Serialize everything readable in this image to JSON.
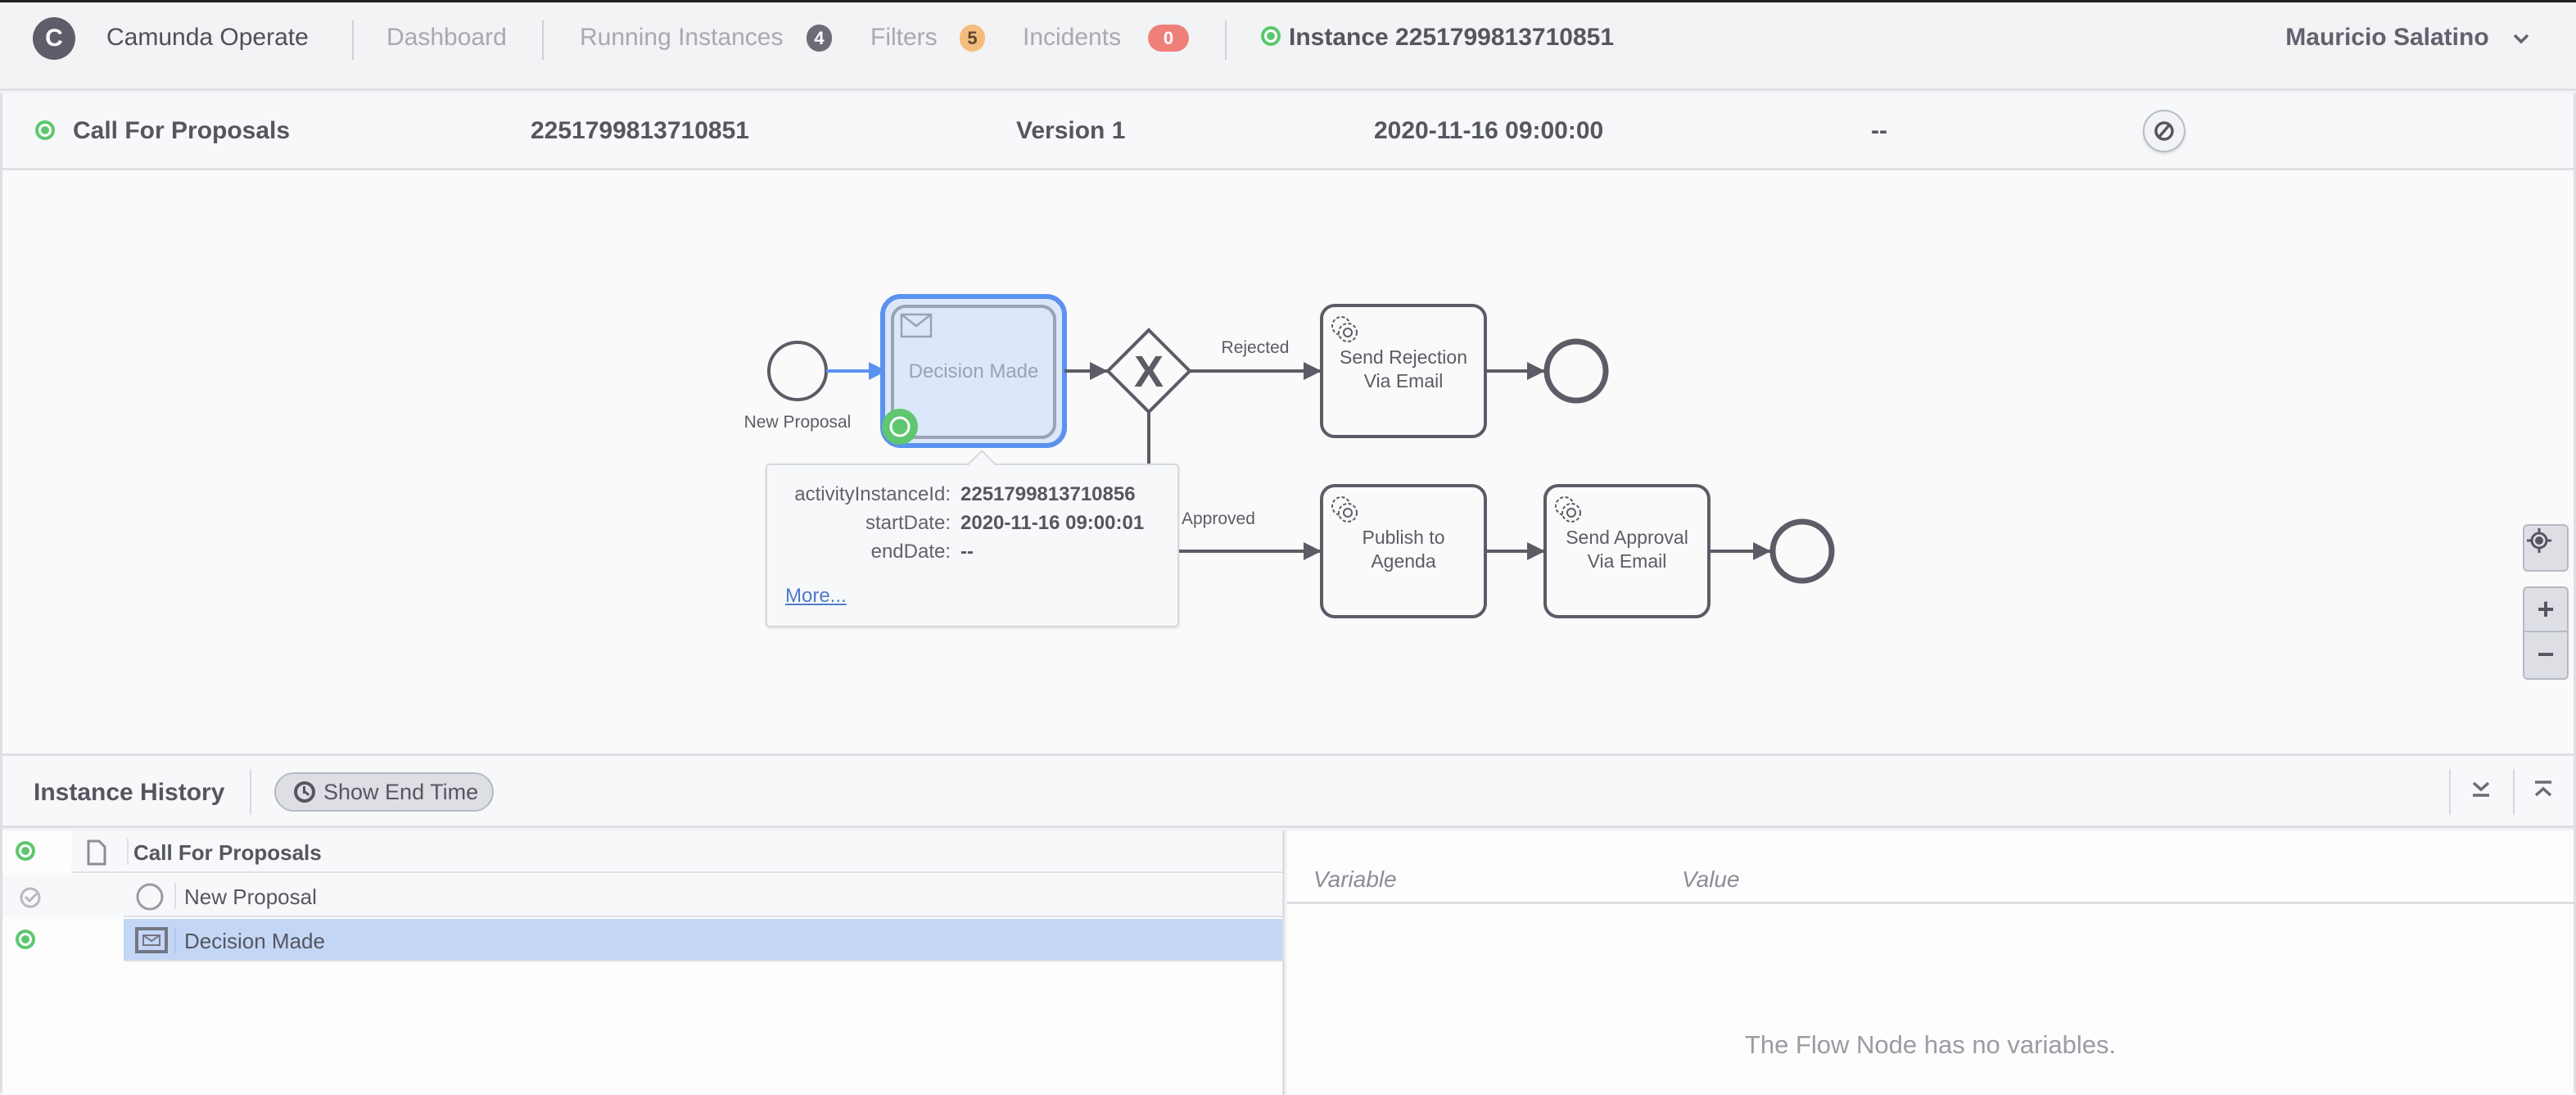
{
  "header": {
    "brand": "Camunda Operate",
    "logo_letter": "C",
    "nav": {
      "dashboard": "Dashboard",
      "running_instances": "Running Instances",
      "running_instances_count": "4",
      "filters": "Filters",
      "filters_count": "5",
      "incidents": "Incidents",
      "incidents_count": "0"
    },
    "instance_link": "Instance 2251799813710851",
    "user": "Mauricio Salatino",
    "colors": {
      "active": "#5ec770",
      "incident": "#ef8079",
      "filters": "#f5bd7d"
    }
  },
  "summary": {
    "process_name": "Call For Proposals",
    "instance_id": "2251799813710851",
    "version": "Version 1",
    "start_date": "2020-11-16 09:00:00",
    "end_date": "--"
  },
  "diagram": {
    "nodes": {
      "start": "New Proposal",
      "decision": "Decision Made",
      "rejection_line1": "Send Rejection",
      "rejection_line2": "Via Email",
      "publish_line1": "Publish to",
      "publish_line2": "Agenda",
      "approval_line1": "Send Approval",
      "approval_line2": "Via Email"
    },
    "flows": {
      "rejected": "Rejected",
      "approved": "Approved"
    },
    "gateway_symbol": "X",
    "popover": {
      "rows": [
        {
          "key": "activityInstanceId:",
          "value": "2251799813710856"
        },
        {
          "key": "startDate:",
          "value": "2020-11-16 09:00:01"
        },
        {
          "key": "endDate:",
          "value": "--"
        }
      ],
      "more_link": "More..."
    },
    "zoom": {
      "zoom_in": "+",
      "zoom_out": "−"
    }
  },
  "history": {
    "title": "Instance History",
    "show_end_time": "Show End Time",
    "rows": [
      {
        "label": "Call For Proposals",
        "status": "active"
      },
      {
        "label": "New Proposal",
        "status": "completed"
      },
      {
        "label": "Decision Made",
        "status": "active",
        "selected": true
      }
    ]
  },
  "variables": {
    "col_variable": "Variable",
    "col_value": "Value",
    "empty_message": "The Flow Node has no variables."
  }
}
